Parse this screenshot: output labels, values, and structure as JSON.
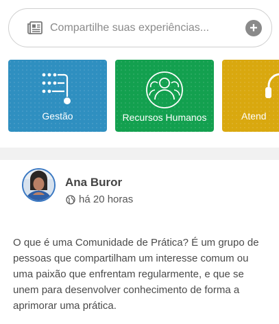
{
  "composer": {
    "placeholder": "Compartilhe suas experiências..."
  },
  "categories": [
    {
      "label": "Gestão",
      "icon": "flow-diagram-icon",
      "color": "#2f8fc0"
    },
    {
      "label": "Recursos Humanos",
      "icon": "person-group-icon",
      "color": "#13a04f"
    },
    {
      "label": "Atend",
      "icon": "headset-icon",
      "color": "#d9a80f"
    }
  ],
  "post": {
    "author": "Ana Buror",
    "time": "há 20 horas",
    "text": "O que é uma Comunidade de Prática? É um grupo de pessoas que compartilham um interesse comum ou uma paixão que enfrentam regularmente, e que se unem para desenvolver conhecimento de forma a aprimorar uma prática."
  }
}
